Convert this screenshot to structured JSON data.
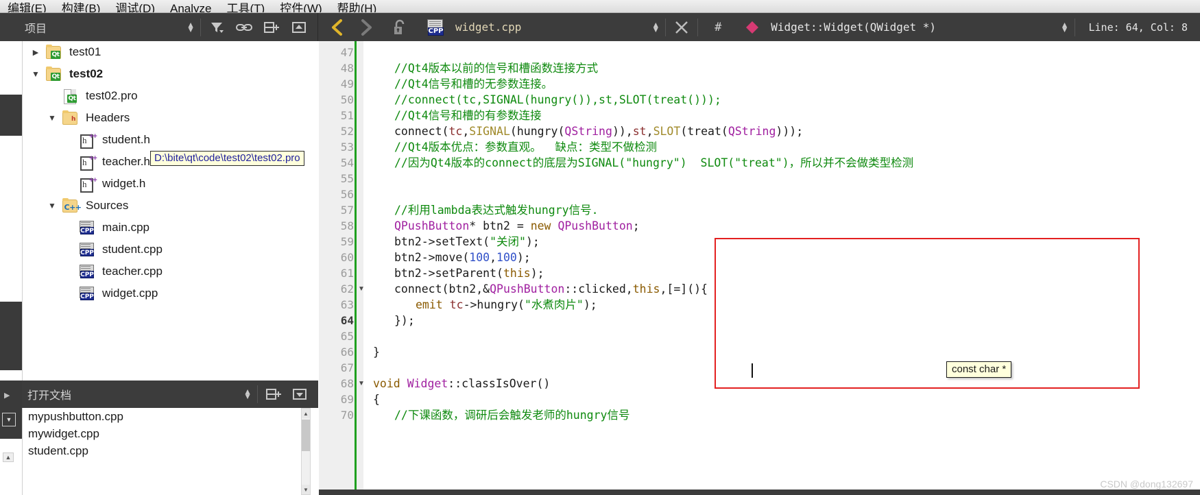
{
  "menubar": {
    "items": [
      {
        "label": "编辑(E)",
        "mnemonic": "E"
      },
      {
        "label": "构建(B)",
        "mnemonic": "B"
      },
      {
        "label": "调试(D)",
        "mnemonic": "D"
      },
      {
        "label": "Analyze",
        "mnemonic": "A"
      },
      {
        "label": "工具(T)",
        "mnemonic": "T"
      },
      {
        "label": "控件(W)",
        "mnemonic": "W"
      },
      {
        "label": "帮助(H)",
        "mnemonic": "H"
      }
    ]
  },
  "toolbar": {
    "sidebar_title": "项目",
    "filter_icon": "filter-icon",
    "link_icon": "link-icon",
    "split_icon": "split-add-icon",
    "close_split_icon": "close-split-icon",
    "back_icon": "navigate-back-icon",
    "forward_icon": "navigate-forward-icon",
    "lock_icon": "unlocked-icon",
    "file_icon": "cpp-file-icon",
    "filename": "widget.cpp",
    "close_icon": "close-document-icon",
    "hash_icon": "#",
    "symbol_marker_icon": "method-diamond-icon",
    "symbol": "Widget::Widget(QWidget *)",
    "line_col": "Line: 64, Col: 8"
  },
  "sidebar": {
    "tree": [
      {
        "label": "test01",
        "indent": 0,
        "twisty": "right",
        "icon": "qt-project-folder-icon",
        "bold": false
      },
      {
        "label": "test02",
        "indent": 0,
        "twisty": "down",
        "icon": "qt-project-folder-icon",
        "bold": true
      },
      {
        "label": "test02.pro",
        "indent": 1,
        "twisty": "none",
        "icon": "qt-pro-file-icon",
        "bold": false
      },
      {
        "label": "Headers",
        "indent": 1,
        "twisty": "down",
        "icon": "headers-folder-icon",
        "bold": false
      },
      {
        "label": "student.h",
        "indent": 2,
        "twisty": "none",
        "icon": "hpp-file-icon",
        "bold": false
      },
      {
        "label": "teacher.h",
        "indent": 2,
        "twisty": "none",
        "icon": "hpp-file-icon",
        "bold": false
      },
      {
        "label": "widget.h",
        "indent": 2,
        "twisty": "none",
        "icon": "hpp-file-icon",
        "bold": false
      },
      {
        "label": "Sources",
        "indent": 1,
        "twisty": "down",
        "icon": "sources-folder-icon",
        "bold": false
      },
      {
        "label": "main.cpp",
        "indent": 2,
        "twisty": "none",
        "icon": "cpp-file-icon",
        "bold": false
      },
      {
        "label": "student.cpp",
        "indent": 2,
        "twisty": "none",
        "icon": "cpp-file-icon",
        "bold": false
      },
      {
        "label": "teacher.cpp",
        "indent": 2,
        "twisty": "none",
        "icon": "cpp-file-icon",
        "bold": false
      },
      {
        "label": "widget.cpp",
        "indent": 2,
        "twisty": "none",
        "icon": "cpp-file-icon",
        "bold": false
      }
    ],
    "path_tooltip": "D:\\bite\\qt\\code\\test02\\test02.pro",
    "opendocs_title": "打开文档",
    "opendocs": [
      {
        "label": "mypushbutton.cpp"
      },
      {
        "label": "mywidget.cpp"
      },
      {
        "label": "student.cpp"
      }
    ]
  },
  "editor": {
    "current_line": 64,
    "lines": [
      {
        "num": 47,
        "fold": "",
        "indent": 0,
        "tokens": []
      },
      {
        "num": 48,
        "fold": "",
        "indent": 1,
        "tokens": [
          {
            "t": "//Qt4版本以前的信号和槽函数连接方式",
            "c": "c-com"
          }
        ]
      },
      {
        "num": 49,
        "fold": "",
        "indent": 1,
        "tokens": [
          {
            "t": "//Qt4信号和槽的无参数连接。",
            "c": "c-com"
          }
        ]
      },
      {
        "num": 50,
        "fold": "",
        "indent": 1,
        "tokens": [
          {
            "t": "//connect(tc,SIGNAL(hungry()),st,SLOT(treat()));",
            "c": "c-com"
          }
        ]
      },
      {
        "num": 51,
        "fold": "",
        "indent": 1,
        "tokens": [
          {
            "t": "//Qt4信号和槽的有参数连接",
            "c": "c-com"
          }
        ]
      },
      {
        "num": 52,
        "fold": "",
        "indent": 1,
        "tokens": [
          {
            "t": "connect(",
            "c": "c-plain"
          },
          {
            "t": "tc",
            "c": "c-field"
          },
          {
            "t": ",",
            "c": "c-plain"
          },
          {
            "t": "SIGNAL",
            "c": "c-macro"
          },
          {
            "t": "(hungry(",
            "c": "c-plain"
          },
          {
            "t": "QString",
            "c": "c-type"
          },
          {
            "t": ")),",
            "c": "c-plain"
          },
          {
            "t": "st",
            "c": "c-field"
          },
          {
            "t": ",",
            "c": "c-plain"
          },
          {
            "t": "SLOT",
            "c": "c-macro"
          },
          {
            "t": "(treat(",
            "c": "c-plain"
          },
          {
            "t": "QString",
            "c": "c-type"
          },
          {
            "t": ")));",
            "c": "c-plain"
          }
        ]
      },
      {
        "num": 53,
        "fold": "",
        "indent": 1,
        "tokens": [
          {
            "t": "//Qt4版本优点：参数直观。  缺点：类型不做检测",
            "c": "c-com"
          }
        ]
      },
      {
        "num": 54,
        "fold": "",
        "indent": 1,
        "tokens": [
          {
            "t": "//因为Qt4版本的connect的底层为SIGNAL(\"hungry\")  SLOT(\"treat\")，所以并不会做类型检测",
            "c": "c-com"
          }
        ]
      },
      {
        "num": 55,
        "fold": "",
        "indent": 0,
        "tokens": []
      },
      {
        "num": 56,
        "fold": "",
        "indent": 0,
        "tokens": []
      },
      {
        "num": 57,
        "fold": "",
        "indent": 1,
        "tokens": [
          {
            "t": "//利用lambda表达式触发hungry信号.",
            "c": "c-com"
          }
        ]
      },
      {
        "num": 58,
        "fold": "",
        "indent": 1,
        "tokens": [
          {
            "t": "QPushButton",
            "c": "c-type"
          },
          {
            "t": "* btn2 = ",
            "c": "c-plain"
          },
          {
            "t": "new",
            "c": "c-kw"
          },
          {
            "t": " ",
            "c": "c-plain"
          },
          {
            "t": "QPushButton",
            "c": "c-type"
          },
          {
            "t": ";",
            "c": "c-plain"
          }
        ]
      },
      {
        "num": 59,
        "fold": "",
        "indent": 1,
        "tokens": [
          {
            "t": "btn2->setText(",
            "c": "c-plain"
          },
          {
            "t": "\"关闭\"",
            "c": "c-str"
          },
          {
            "t": ");",
            "c": "c-plain"
          }
        ]
      },
      {
        "num": 60,
        "fold": "",
        "indent": 1,
        "tokens": [
          {
            "t": "btn2->move(",
            "c": "c-plain"
          },
          {
            "t": "100",
            "c": "c-num"
          },
          {
            "t": ",",
            "c": "c-plain"
          },
          {
            "t": "100",
            "c": "c-num"
          },
          {
            "t": ");",
            "c": "c-plain"
          }
        ]
      },
      {
        "num": 61,
        "fold": "",
        "indent": 1,
        "tokens": [
          {
            "t": "btn2->setParent(",
            "c": "c-plain"
          },
          {
            "t": "this",
            "c": "c-kw"
          },
          {
            "t": ");",
            "c": "c-plain"
          }
        ]
      },
      {
        "num": 62,
        "fold": "down",
        "indent": 1,
        "tokens": [
          {
            "t": "connect(btn2,&",
            "c": "c-plain"
          },
          {
            "t": "QPushButton",
            "c": "c-type"
          },
          {
            "t": "::clicked,",
            "c": "c-plain"
          },
          {
            "t": "this",
            "c": "c-kw"
          },
          {
            "t": ",[=](){",
            "c": "c-plain"
          }
        ]
      },
      {
        "num": 63,
        "fold": "",
        "indent": 2,
        "tokens": [
          {
            "t": "emit",
            "c": "c-kw"
          },
          {
            "t": " ",
            "c": "c-plain"
          },
          {
            "t": "tc",
            "c": "c-field"
          },
          {
            "t": "->hungry(",
            "c": "c-plain"
          },
          {
            "t": "\"水煮肉片\"",
            "c": "c-str"
          },
          {
            "t": ");",
            "c": "c-plain"
          }
        ]
      },
      {
        "num": 64,
        "fold": "",
        "indent": 1,
        "tokens": [
          {
            "t": "});",
            "c": "c-plain"
          }
        ]
      },
      {
        "num": 65,
        "fold": "",
        "indent": 0,
        "tokens": []
      },
      {
        "num": 66,
        "fold": "",
        "indent": 0,
        "tokens": [
          {
            "t": "}",
            "c": "c-plain"
          }
        ]
      },
      {
        "num": 67,
        "fold": "",
        "indent": 0,
        "tokens": []
      },
      {
        "num": 68,
        "fold": "down",
        "indent": 0,
        "tokens": [
          {
            "t": "void",
            "c": "c-void"
          },
          {
            "t": " ",
            "c": "c-plain"
          },
          {
            "t": "Widget",
            "c": "c-type"
          },
          {
            "t": "::",
            "c": "c-plain"
          },
          {
            "t": "classIsOver",
            "c": "c-plain"
          },
          {
            "t": "()",
            "c": "c-plain"
          }
        ]
      },
      {
        "num": 69,
        "fold": "",
        "indent": 0,
        "tokens": [
          {
            "t": "{",
            "c": "c-plain"
          }
        ]
      },
      {
        "num": 70,
        "fold": "",
        "indent": 1,
        "tokens": [
          {
            "t": "//下课函数，调研后会触发老师的hungry信号",
            "c": "c-com"
          }
        ]
      }
    ],
    "completion_tooltip": "const char *",
    "highlight_box_color": "#e32020"
  },
  "watermark": "CSDN @dong132697"
}
